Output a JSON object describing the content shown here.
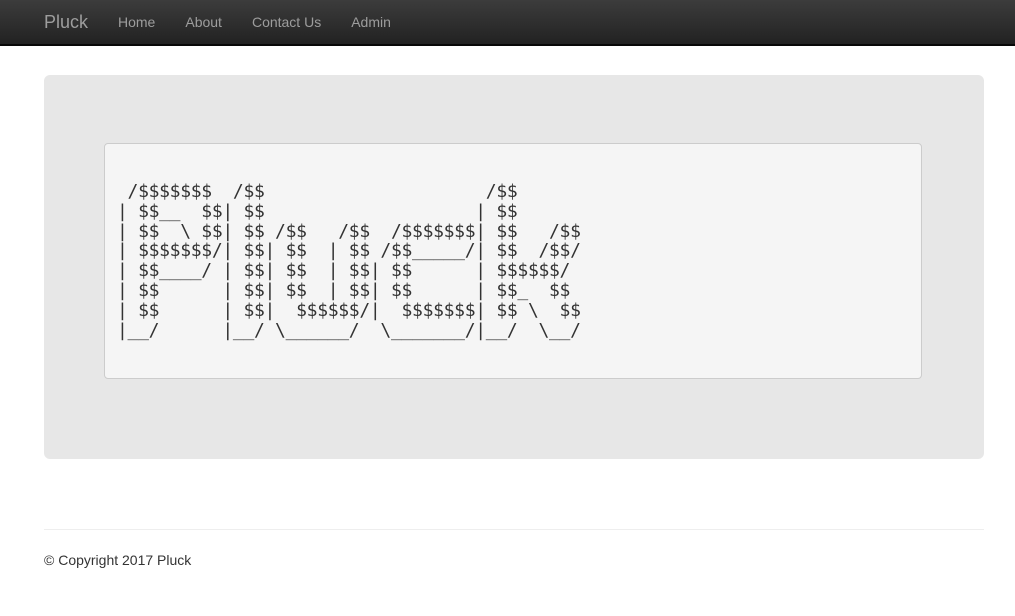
{
  "navbar": {
    "brand": "Pluck",
    "items": [
      {
        "label": "Home"
      },
      {
        "label": "About"
      },
      {
        "label": "Contact Us"
      },
      {
        "label": "Admin"
      }
    ]
  },
  "main": {
    "ascii_art": " /$$$$$$$  /$$                     /$$\n| $$__  $$| $$                    | $$\n| $$  \\ $$| $$ /$$   /$$  /$$$$$$$| $$   /$$\n| $$$$$$$/| $$| $$  | $$ /$$_____/| $$  /$$/\n| $$____/ | $$| $$  | $$| $$      | $$$$$$/\n| $$      | $$| $$  | $$| $$      | $$_  $$\n| $$      | $$|  $$$$$$/|  $$$$$$$| $$ \\  $$\n|__/      |__/ \\______/  \\_______/|__/  \\__/"
  },
  "footer": {
    "copyright": "© Copyright 2017 Pluck"
  },
  "colors": {
    "navbar_bg": "#222222",
    "nav_text": "#9d9d9d",
    "jumbotron_bg": "#e7e7e7",
    "pre_bg": "#f5f5f5"
  }
}
